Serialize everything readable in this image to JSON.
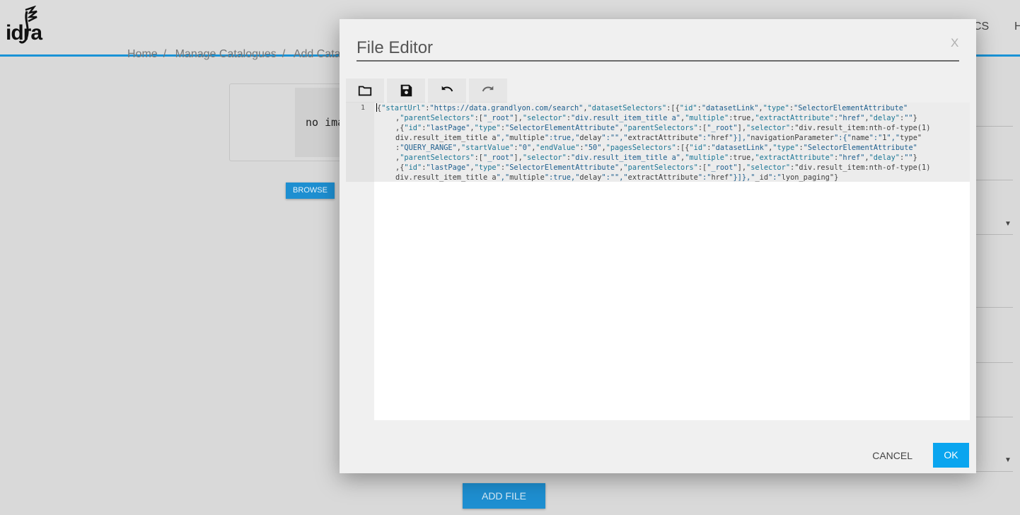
{
  "app": {
    "logo_text": "idra",
    "nav": [
      "CS",
      "H"
    ]
  },
  "breadcrumb": [
    "Home",
    "Manage Catalogues",
    "Add Catal"
  ],
  "background": {
    "image_placeholder": "no ima",
    "browse_label": "BROWSE",
    "add_file_label": "ADD FILE"
  },
  "modal": {
    "title": "File Editor",
    "close_label": "X",
    "toolbar": [
      {
        "name": "open-folder-icon"
      },
      {
        "name": "save-icon"
      },
      {
        "name": "undo-icon"
      },
      {
        "name": "redo-icon"
      }
    ],
    "editor": {
      "line_number": "1",
      "lines": [
        "{\"startUrl\":\"https://data.grandlyon.com/search\",\"datasetSelectors\":[{\"id\":\"datasetLink\",\"type\":\"SelectorElementAttribute\"",
        ",\"parentSelectors\":[\"_root\"],\"selector\":\"div.result_item_title a\",\"multiple\":true,\"extractAttribute\":\"href\",\"delay\":\"\"}",
        ",{\"id\":\"lastPage\",\"type\":\"SelectorElementAttribute\",\"parentSelectors\":[\"_root\"],\"selector\":\"div.result_item:nth-of-type(1)",
        "div.result_item_title a\",\"multiple\":true,\"delay\":\"\",\"extractAttribute\":\"href\"}],\"navigationParameter\":{\"name\":\"1\",\"type\"",
        ":\"QUERY_RANGE\",\"startValue\":\"0\",\"endValue\":\"50\",\"pagesSelectors\":[{\"id\":\"datasetLink\",\"type\":\"SelectorElementAttribute\"",
        ",\"parentSelectors\":[\"_root\"],\"selector\":\"div.result_item_title a\",\"multiple\":true,\"extractAttribute\":\"href\",\"delay\":\"\"}",
        ",{\"id\":\"lastPage\",\"type\":\"SelectorElementAttribute\",\"parentSelectors\":[\"_root\"],\"selector\":\"div.result_item:nth-of-type(1)",
        "div.result_item_title a\",\"multiple\":true,\"delay\":\"\",\"extractAttribute\":\"href\"}]},\"_id\":\"lyon_paging\"}"
      ]
    },
    "cancel_label": "CANCEL",
    "ok_label": "OK"
  },
  "colors": {
    "accent": "#0aa5ef",
    "header_border": "#1a93d6"
  }
}
